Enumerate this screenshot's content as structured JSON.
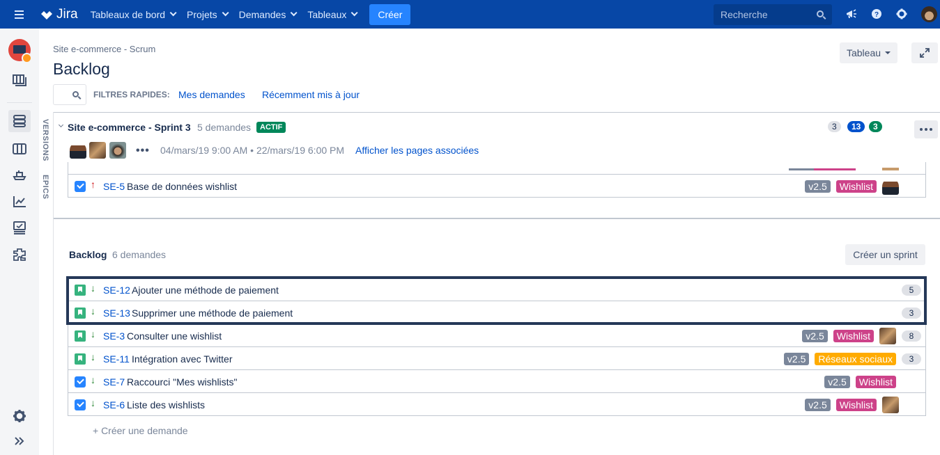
{
  "topnav": {
    "brand": "Jira",
    "items": [
      {
        "label": "Tableaux de bord"
      },
      {
        "label": "Projets"
      },
      {
        "label": "Demandes"
      },
      {
        "label": "Tableaux"
      }
    ],
    "create_label": "Créer",
    "search_placeholder": "Recherche",
    "icons": [
      "notifications-icon",
      "help-icon",
      "settings-icon",
      "profile-avatar"
    ]
  },
  "sidebar": {
    "icons": [
      "project-avatar",
      "releases-icon",
      "backlog-icon",
      "board-icon",
      "deployments-icon",
      "reports-icon",
      "issues-icon",
      "addons-icon",
      "project-settings-icon",
      "expand-icon"
    ],
    "active": "backlog-icon"
  },
  "vertical_tabs": [
    "VERSIONS",
    "EPICS"
  ],
  "header": {
    "breadcrumb": "Site e-commerce - Scrum",
    "title": "Backlog",
    "quick_filters_label": "FILTRES RAPIDES:",
    "quick_filters": [
      "Mes demandes",
      "Récemment mis à jour"
    ],
    "board_button": "Tableau"
  },
  "sprint": {
    "name": "Site e-commerce - Sprint 3",
    "count": "5 demandes",
    "status": "ACTIF",
    "more": "•••",
    "dates": "04/mars/19 9:00 AM  •  22/mars/19 6:00 PM",
    "link": "Afficher les pages associées",
    "points": {
      "todo": "3",
      "in_progress": "13",
      "done": "3"
    },
    "issues": [
      {
        "type": "task",
        "priority": "up",
        "key": "SE-5",
        "summary": "Base de données wishlist",
        "version": "v2.5",
        "label": "Wishlist",
        "label_kind": "wish",
        "assignee": true,
        "estimate": ""
      }
    ]
  },
  "backlog": {
    "title": "Backlog",
    "count": "6 demandes",
    "create_sprint": "Créer un sprint",
    "issues": [
      {
        "type": "story",
        "priority": "down",
        "key": "SE-12",
        "summary": "Ajouter une méthode de paiement",
        "version": "",
        "label": "",
        "assignee": false,
        "estimate": "5"
      },
      {
        "type": "story",
        "priority": "down",
        "key": "SE-13",
        "summary": "Supprimer une méthode de paiement",
        "version": "",
        "label": "",
        "assignee": false,
        "estimate": "3"
      },
      {
        "type": "story",
        "priority": "down",
        "key": "SE-3",
        "summary": "Consulter une wishlist",
        "version": "v2.5",
        "label": "Wishlist",
        "label_kind": "wish",
        "assignee": true,
        "estimate": "8"
      },
      {
        "type": "story",
        "priority": "down",
        "key": "SE-11",
        "summary": "Intégration avec Twitter",
        "version": "v2.5",
        "label": "Réseaux sociaux",
        "label_kind": "social",
        "assignee": false,
        "estimate": "3"
      },
      {
        "type": "task",
        "priority": "down",
        "key": "SE-7",
        "summary": "Raccourci \"Mes wishlists\"",
        "version": "v2.5",
        "label": "Wishlist",
        "label_kind": "wish",
        "assignee": false,
        "estimate": ""
      },
      {
        "type": "task",
        "priority": "down",
        "key": "SE-6",
        "summary": "Liste des wishlists",
        "version": "v2.5",
        "label": "Wishlist",
        "label_kind": "wish",
        "assignee": true,
        "estimate": ""
      }
    ],
    "create_issue": "+  Créer une demande"
  },
  "colors": {
    "nav_bg": "#0747a6",
    "create_btn": "#2684ff",
    "active_badge": "#00875a",
    "link": "#0052cc",
    "label_wishlist": "#cd4289",
    "label_social": "#ffab00",
    "label_version": "#7a869a",
    "highlight_border": "#253858"
  }
}
